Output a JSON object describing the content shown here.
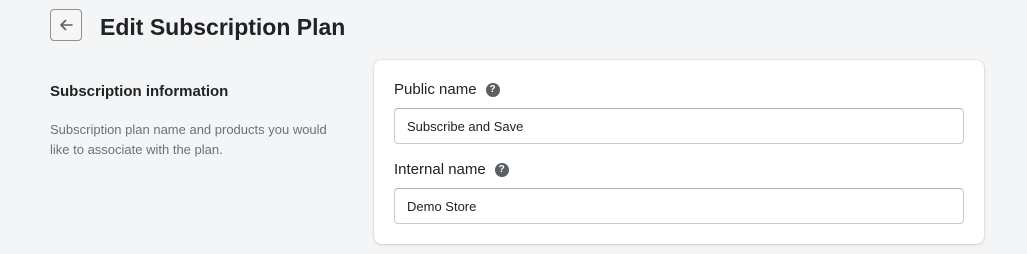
{
  "header": {
    "back_icon": "arrow-left-icon",
    "title": "Edit Subscription Plan"
  },
  "section": {
    "heading": "Subscription information",
    "description": "Subscription plan name and products you would like to associate with the plan."
  },
  "form": {
    "public_name": {
      "label": "Public name",
      "help_icon": "question-circle-icon",
      "help_glyph": "?",
      "value": "Subscribe and Save"
    },
    "internal_name": {
      "label": "Internal name",
      "help_icon": "question-circle-icon",
      "help_glyph": "?",
      "value": "Demo Store"
    }
  }
}
